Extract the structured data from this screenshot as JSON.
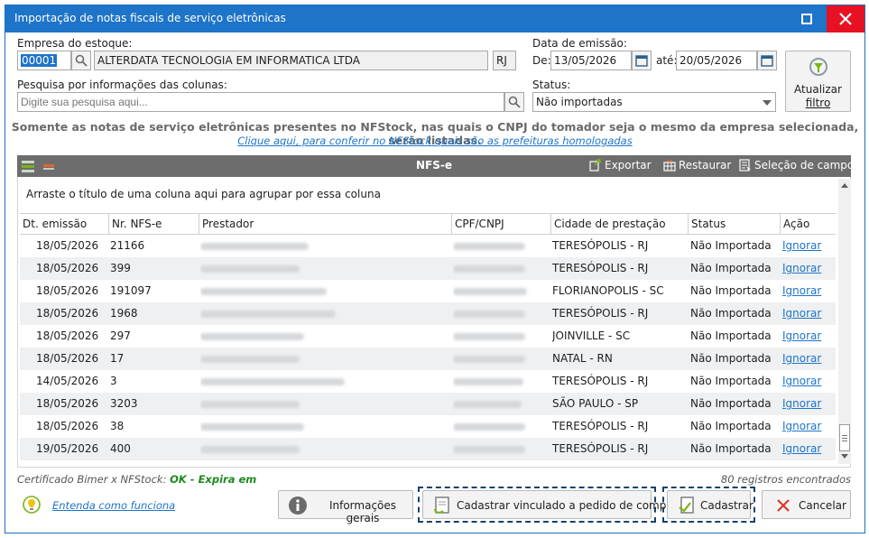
{
  "window": {
    "title": "Importação de notas fiscais de serviço eletrônicas"
  },
  "form": {
    "empresa_label": "Empresa do estoque:",
    "empresa_code": "00001",
    "empresa_name": "ALTERDATA TECNOLOGIA EM INFORMATICA LTDA",
    "empresa_uf": "RJ",
    "data_label": "Data de emissão:",
    "de_label": "De:",
    "de_value": "13/05/2026",
    "ate_label": "até:",
    "ate_value": "20/05/2026",
    "pesquisa_label": "Pesquisa por informações das colunas:",
    "pesquisa_placeholder": "Digite sua pesquisa aqui...",
    "status_label": "Status:",
    "status_value": "Não importadas",
    "atualizar_line1": "Atualizar",
    "atualizar_line2": "filtro"
  },
  "info": {
    "notice": "Somente as notas de serviço eletrônicas presentes no NFStock, nas quais o CNPJ do tomador seja o mesmo da empresa selecionada, serão listadas.",
    "link": "Clique aqui, para conferir no NFStock quais são as prefeituras homologadas"
  },
  "grid": {
    "title": "NFS-e",
    "exportar": "Exportar",
    "restaurar": "Restaurar",
    "selecao": "Seleção de campos",
    "group_hint": "Arraste o título de uma coluna aqui para agrupar por essa coluna",
    "columns": {
      "dt": "Dt. emissão",
      "nr": "Nr. NFS-e",
      "prestador": "Prestador",
      "cpf": "CPF/CNPJ",
      "cidade": "Cidade de prestação",
      "status": "Status",
      "acao": "Ação"
    },
    "rows": [
      {
        "dt": "18/05/2026",
        "nr": "21166",
        "cidade": "TERESÓPOLIS - RJ",
        "status": "Não Importada",
        "acao": "Ignorar"
      },
      {
        "dt": "18/05/2026",
        "nr": "399",
        "cidade": "TERESÓPOLIS - RJ",
        "status": "Não Importada",
        "acao": "Ignorar"
      },
      {
        "dt": "18/05/2026",
        "nr": "191097",
        "cidade": "FLORIANOPOLIS - SC",
        "status": "Não Importada",
        "acao": "Ignorar"
      },
      {
        "dt": "18/05/2026",
        "nr": "1968",
        "cidade": "TERESÓPOLIS - RJ",
        "status": "Não Importada",
        "acao": "Ignorar"
      },
      {
        "dt": "18/05/2026",
        "nr": "297",
        "cidade": "JOINVILLE - SC",
        "status": "Não Importada",
        "acao": "Ignorar"
      },
      {
        "dt": "18/05/2026",
        "nr": "17",
        "cidade": "NATAL - RN",
        "status": "Não Importada",
        "acao": "Ignorar"
      },
      {
        "dt": "14/05/2026",
        "nr": "3",
        "cidade": "TERESÓPOLIS - RJ",
        "status": "Não Importada",
        "acao": "Ignorar"
      },
      {
        "dt": "18/05/2026",
        "nr": "3203",
        "cidade": "SÃO PAULO - SP",
        "status": "Não Importada",
        "acao": "Ignorar"
      },
      {
        "dt": "18/05/2026",
        "nr": "38",
        "cidade": "TERESÓPOLIS - RJ",
        "status": "Não Importada",
        "acao": "Ignorar"
      },
      {
        "dt": "19/05/2026",
        "nr": "400",
        "cidade": "TERESÓPOLIS - RJ",
        "status": "Não Importada",
        "acao": "Ignorar"
      }
    ]
  },
  "footer": {
    "cert_label": "Certificado Bimer x NFStock:",
    "cert_status": "OK - Expira em",
    "records": "80 registros encontrados",
    "entenda": "Entenda como funciona",
    "informacoes": "Informações gerais",
    "cadastrar_vinculado": "Cadastrar vinculado a pedido de compra",
    "cadastrar": "Cadastrar",
    "cancelar": "Cancelar"
  },
  "colors": {
    "title_bar": "#1e74c8",
    "close": "#e81123",
    "grid_header": "#6d6d6d",
    "ok_green": "#1c8a1c",
    "link": "#1e74c8"
  }
}
